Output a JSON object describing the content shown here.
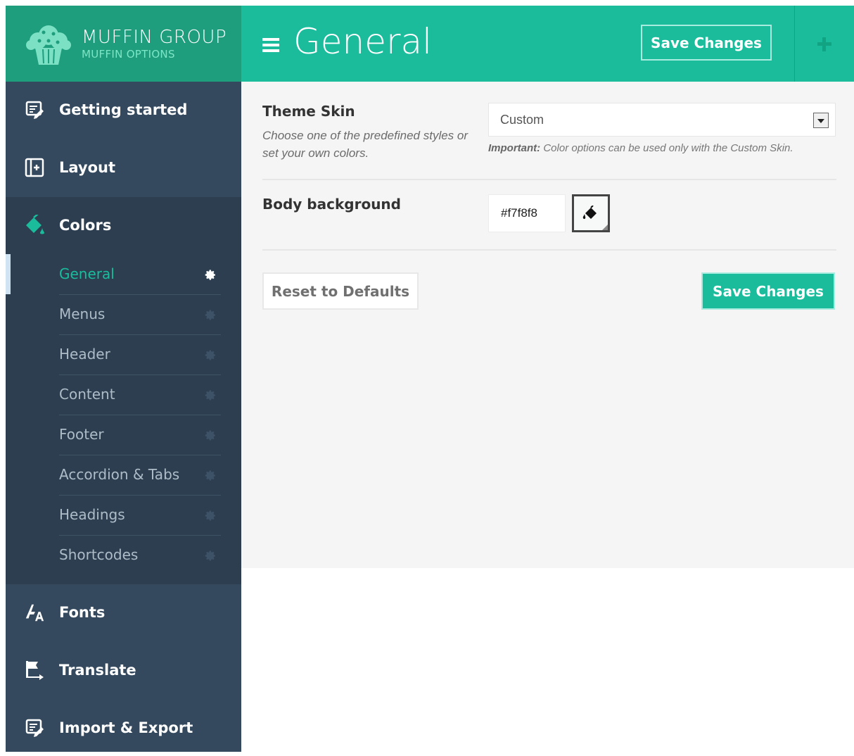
{
  "brand": {
    "title": "MUFFIN GROUP",
    "subtitle": "MUFFIN OPTIONS",
    "logo_icon": "muffin-icon"
  },
  "sidebar": {
    "items": [
      {
        "label": "Getting started",
        "icon": "edit-document-icon"
      },
      {
        "label": "Layout",
        "icon": "layout-plus-icon"
      },
      {
        "label": "Colors",
        "icon": "paint-bucket-icon"
      },
      {
        "label": "Fonts",
        "icon": "font-icon"
      },
      {
        "label": "Translate",
        "icon": "flag-icon"
      },
      {
        "label": "Import & Export",
        "icon": "edit-document-icon"
      }
    ],
    "colors_sub": [
      {
        "label": "General",
        "active": true
      },
      {
        "label": "Menus"
      },
      {
        "label": "Header"
      },
      {
        "label": "Content"
      },
      {
        "label": "Footer"
      },
      {
        "label": "Accordion & Tabs"
      },
      {
        "label": "Headings"
      },
      {
        "label": "Shortcodes"
      }
    ]
  },
  "header": {
    "title": "General",
    "save_label": "Save Changes"
  },
  "options": {
    "theme_skin": {
      "title": "Theme Skin",
      "description": "Choose one of the predefined styles or set your own colors.",
      "selected": "Custom",
      "note_bold": "Important:",
      "note_text": "Color options can be used only with the Custom Skin."
    },
    "body_background": {
      "title": "Body background",
      "value": "#f7f8f8"
    }
  },
  "actions": {
    "reset_label": "Reset to Defaults",
    "save_label": "Save Changes"
  },
  "colors": {
    "accent": "#1abc9c",
    "accent_dark": "#1e9e7d",
    "sidebar": "#34495e",
    "sidebar_dark": "#2c3e50",
    "panel": "#f5f5f5"
  }
}
